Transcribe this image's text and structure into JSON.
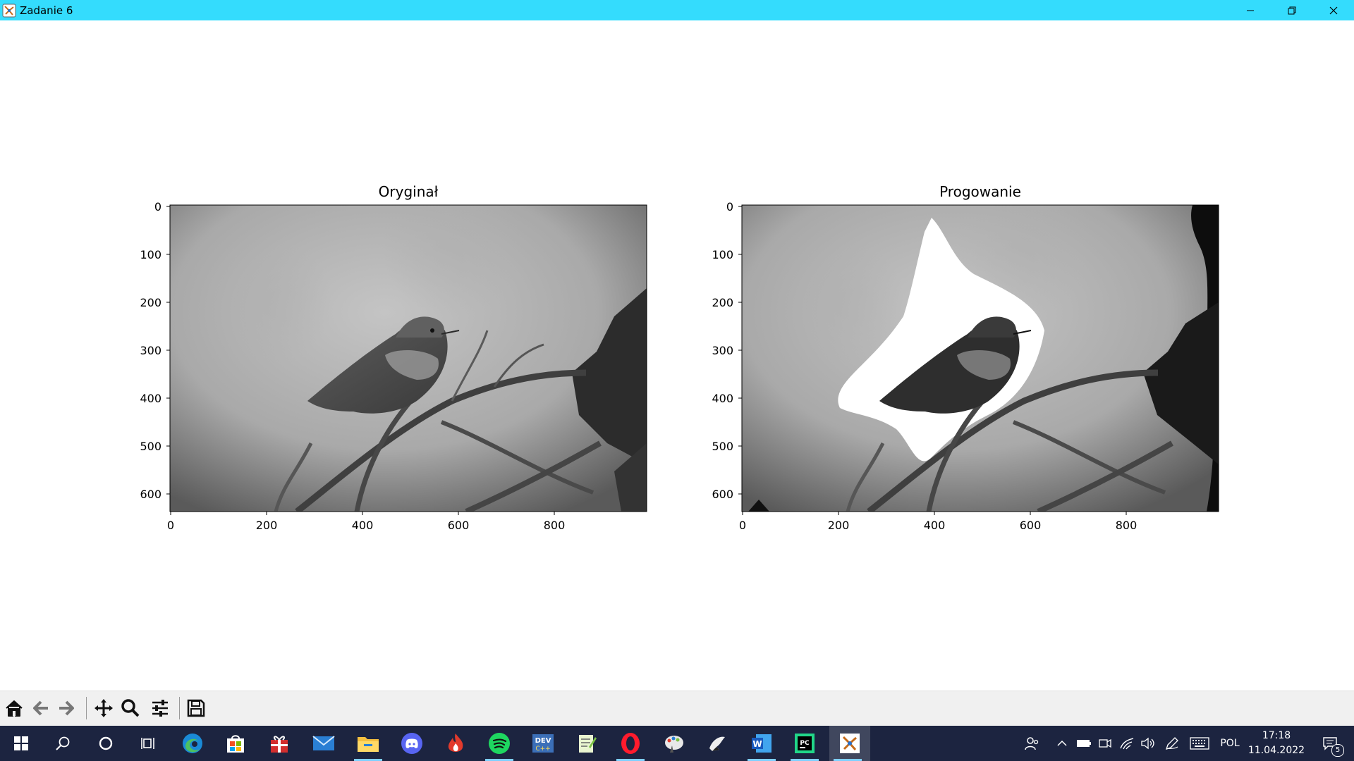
{
  "window": {
    "title": "Zadanie 6",
    "controls": [
      "minimize",
      "restore",
      "close"
    ],
    "titlebar_color": "#34dcfd"
  },
  "figure": {
    "subplots": [
      {
        "title": "Oryginał",
        "x_ticks": [
          "0",
          "200",
          "400",
          "600",
          "800"
        ],
        "y_ticks": [
          "0",
          "100",
          "200",
          "300",
          "400",
          "500",
          "600"
        ],
        "image": "grayscale photo of a hummingbird perched on a branch"
      },
      {
        "title": "Progowanie",
        "x_ticks": [
          "0",
          "200",
          "400",
          "600",
          "800"
        ],
        "y_ticks": [
          "0",
          "100",
          "200",
          "300",
          "400",
          "500",
          "600"
        ],
        "image": "thresholded grayscale hummingbird with white region around the bird"
      }
    ]
  },
  "toolbar": {
    "buttons": [
      {
        "name": "home",
        "icon": "home-icon"
      },
      {
        "name": "back",
        "icon": "arrow-left-icon"
      },
      {
        "name": "forward",
        "icon": "arrow-right-icon"
      },
      {
        "name": "pan",
        "icon": "move-icon"
      },
      {
        "name": "zoom",
        "icon": "magnifier-icon"
      },
      {
        "name": "configure-subplots",
        "icon": "sliders-icon"
      },
      {
        "name": "save",
        "icon": "floppy-disk-icon"
      }
    ]
  },
  "taskbar": {
    "apps": [
      {
        "name": "start",
        "icon": "windows-logo-icon"
      },
      {
        "name": "search",
        "icon": "search-icon"
      },
      {
        "name": "cortana",
        "icon": "circle-icon"
      },
      {
        "name": "task-view",
        "icon": "task-view-icon"
      },
      {
        "name": "edge",
        "icon": "edge-icon"
      },
      {
        "name": "store",
        "icon": "store-icon"
      },
      {
        "name": "gift",
        "icon": "gift-icon"
      },
      {
        "name": "mail",
        "icon": "mail-icon"
      },
      {
        "name": "file-explorer",
        "icon": "folder-icon"
      },
      {
        "name": "discord",
        "icon": "discord-icon"
      },
      {
        "name": "firebird",
        "icon": "flame-icon"
      },
      {
        "name": "spotify",
        "icon": "spotify-icon"
      },
      {
        "name": "dev-cpp",
        "icon": "dev-cpp-icon"
      },
      {
        "name": "notepad-plus-plus",
        "icon": "notepad-icon"
      },
      {
        "name": "opera",
        "icon": "opera-icon"
      },
      {
        "name": "paint",
        "icon": "paint-icon"
      },
      {
        "name": "inkscape",
        "icon": "inkscape-icon"
      },
      {
        "name": "word",
        "icon": "word-icon"
      },
      {
        "name": "pycharm",
        "icon": "pycharm-icon"
      },
      {
        "name": "matplotlib-window",
        "icon": "matplotlib-icon"
      }
    ],
    "tray": {
      "language": "POL",
      "time": "17:18",
      "date": "11.04.2022",
      "notifications": "5"
    }
  }
}
